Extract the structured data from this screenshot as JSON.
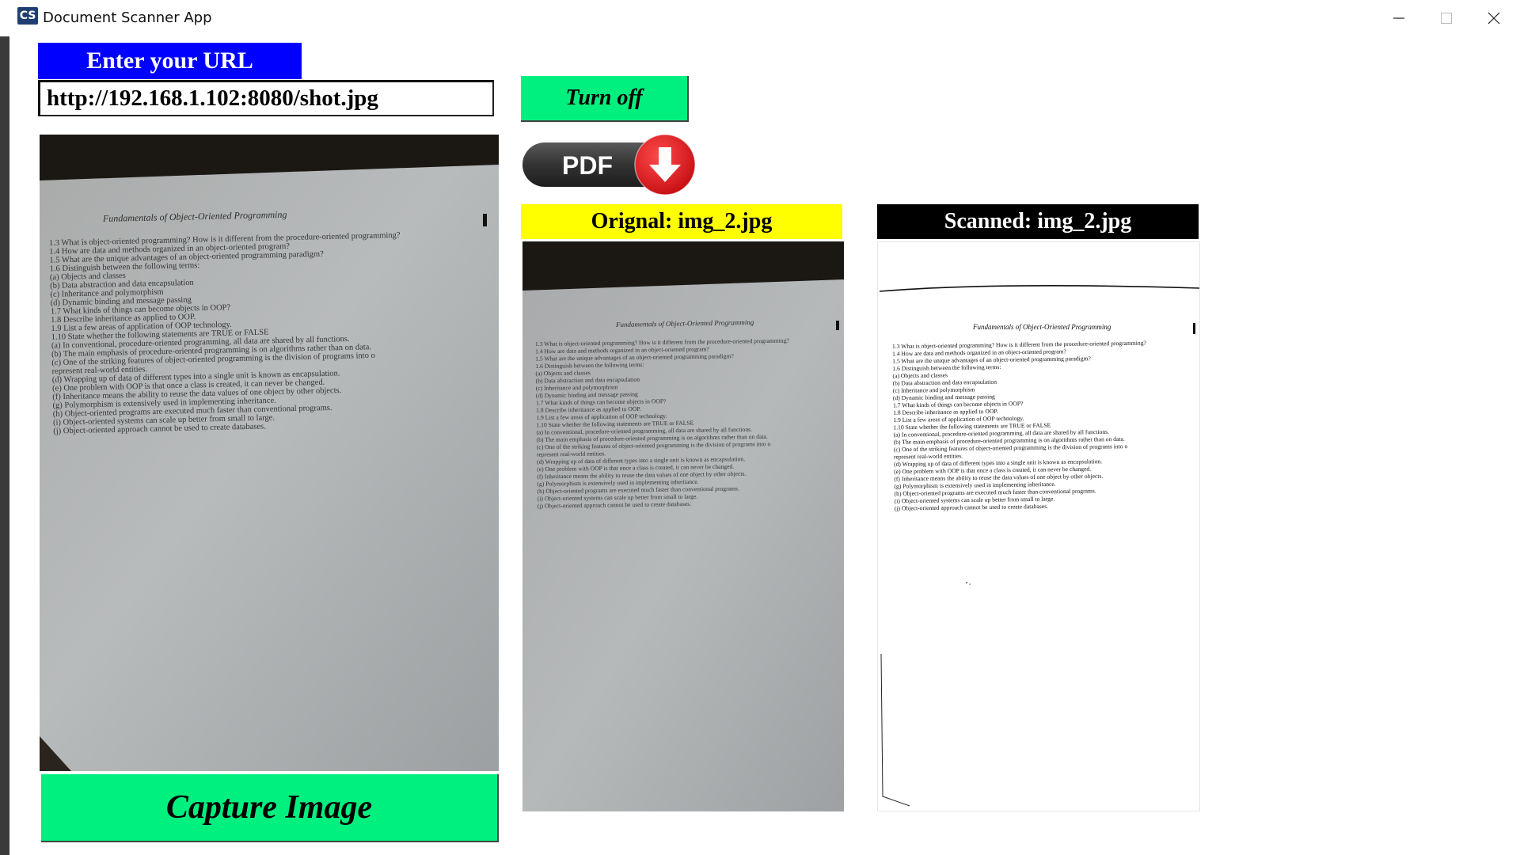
{
  "window": {
    "icon_text": "CS",
    "title": "Document Scanner App",
    "controls": [
      "minimize-icon",
      "maximize-icon",
      "close-icon"
    ]
  },
  "url_section": {
    "label": "Enter your URL",
    "input_value": "http://192.168.1.102:8080/shot.jpg"
  },
  "controls": {
    "turn_off_label": "Turn off",
    "pdf_label": "PDF",
    "pdf_icon": "download-arrow-icon",
    "capture_label": "Capture Image"
  },
  "panels": {
    "original_label": "Orignal: img_2.jpg",
    "scanned_label": "Scanned: img_2.jpg"
  },
  "document": {
    "heading": "Fundamentals of Object-Oriented Programming",
    "lines": [
      "1.3  What is object-oriented programming? How is it different from the procedure-oriented programming?",
      "1.4  How are data and methods organized in an object-oriented program?",
      "1.5  What are the unique advantages of an object-oriented programming paradigm?",
      "1.6  Distinguish between the following terms:",
      "      (a) Objects and classes",
      "      (b) Data abstraction and data encapsulation",
      "      (c) Inheritance and polymorphism",
      "      (d) Dynamic binding and message passing",
      "1.7  What kinds of things can become objects in OOP?",
      "1.8  Describe inheritance as applied to OOP.",
      "1.9  List a few areas of application of OOP technology.",
      "1.10  State whether the following statements are TRUE or FALSE",
      "      (a) In conventional, procedure-oriented programming, all data are shared by all functions.",
      "      (b) The main emphasis of procedure-oriented programming is on algorithms rather than on data.",
      "      (c) One of the striking features of object-oriented programming is the division of programs into o",
      "           represent real-world entities.",
      "      (d) Wrapping up of data of different types into a single unit is known as encapsulation.",
      "      (e) One problem with OOP is that once a class is created, it can never be changed.",
      "      (f) Inheritance means the ability to reuse the data values of one object by other objects.",
      "      (g) Polymorphism is extensively used in implementing inheritance.",
      "      (h) Object-oriented programs are executed much faster than conventional programs.",
      "      (i) Object-oriented systems can scale up better from small to large.",
      "      (j) Object-oriented approach cannot be used to create databases."
    ]
  },
  "colors": {
    "url_label_bg": "#0000ff",
    "button_green": "#00f07f",
    "original_label_bg": "#ffff00",
    "scanned_label_bg": "#000000",
    "pdf_red": "#e0141e",
    "pdf_dark": "#3b3b3b"
  }
}
